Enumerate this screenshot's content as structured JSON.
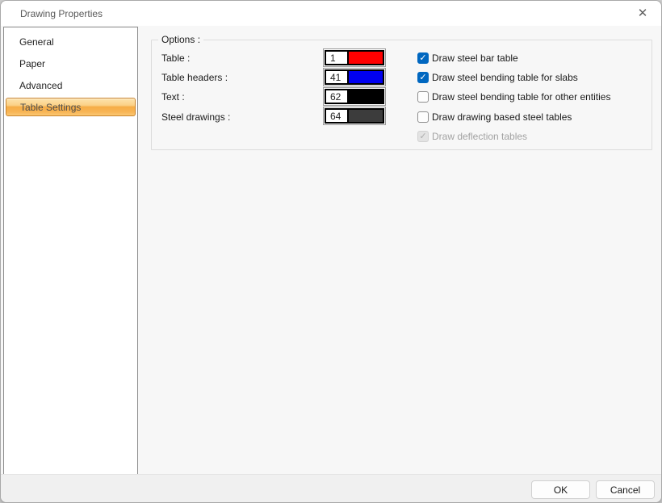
{
  "window": {
    "title": "Drawing Properties",
    "close_glyph": "✕"
  },
  "sidebar": {
    "items": [
      {
        "label": "General",
        "selected": false
      },
      {
        "label": "Paper",
        "selected": false
      },
      {
        "label": "Advanced",
        "selected": false
      },
      {
        "label": "Table Settings",
        "selected": true
      }
    ]
  },
  "options_group": {
    "legend": "Options :",
    "fields": [
      {
        "label": "Table :",
        "value": "1",
        "color": "#ff0000"
      },
      {
        "label": "Table headers :",
        "value": "41",
        "color": "#0000f0"
      },
      {
        "label": "Text :",
        "value": "62",
        "color": "#000000"
      },
      {
        "label": "Steel drawings :",
        "value": "64",
        "color": "#3c3c3c"
      }
    ],
    "checkboxes": [
      {
        "label": "Draw steel bar table",
        "checked": true,
        "disabled": false
      },
      {
        "label": "Draw steel bending table for slabs",
        "checked": true,
        "disabled": false
      },
      {
        "label": "Draw steel bending table for other entities",
        "checked": false,
        "disabled": false
      },
      {
        "label": "Draw drawing based steel tables",
        "checked": false,
        "disabled": false
      },
      {
        "label": "Draw deflection tables",
        "checked": true,
        "disabled": true
      }
    ],
    "check_glyph": "✓"
  },
  "footer": {
    "ok_label": "OK",
    "cancel_label": "Cancel"
  },
  "colors": {
    "checkbox_accent": "#0067c0",
    "selection_gradient_top": "#fde3ae",
    "selection_gradient_bottom": "#f6ad46",
    "selection_border": "#c8832c"
  }
}
